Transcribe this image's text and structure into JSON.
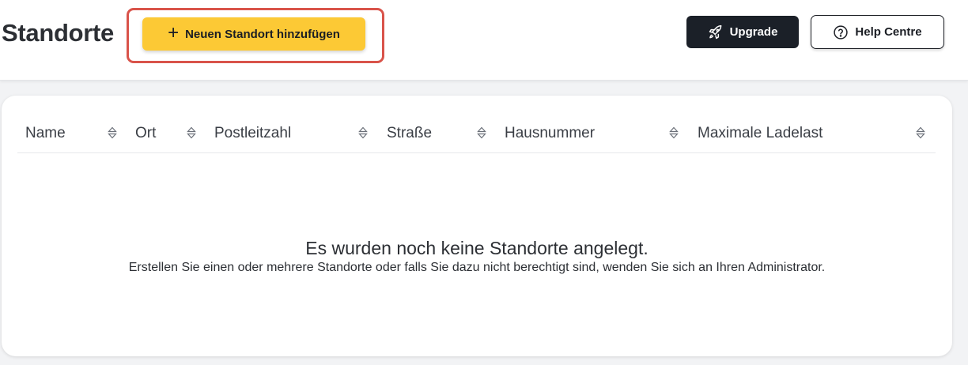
{
  "header": {
    "title": "Standorte",
    "add_button_label": "Neuen Standort hinzufügen",
    "add_button_icon": "plus-icon",
    "upgrade_label": "Upgrade",
    "upgrade_icon": "rocket-icon",
    "help_label": "Help Centre",
    "help_icon": "question-circle-icon"
  },
  "table": {
    "columns": [
      {
        "label": "Name"
      },
      {
        "label": "Ort"
      },
      {
        "label": "Postleitzahl"
      },
      {
        "label": "Straße"
      },
      {
        "label": "Hausnummer"
      },
      {
        "label": "Maximale Ladelast"
      }
    ],
    "empty_title": "Es wurden noch keine Standorte angelegt.",
    "empty_subtitle": "Erstellen Sie einen oder mehrere Standorte oder falls Sie dazu nicht berechtigt sind, wenden Sie sich an Ihren Administrator."
  },
  "colors": {
    "accent_yellow": "#fcc935",
    "dark_button": "#1b2028",
    "highlight_red": "#d9534a",
    "page_background": "#f2f3f5"
  }
}
